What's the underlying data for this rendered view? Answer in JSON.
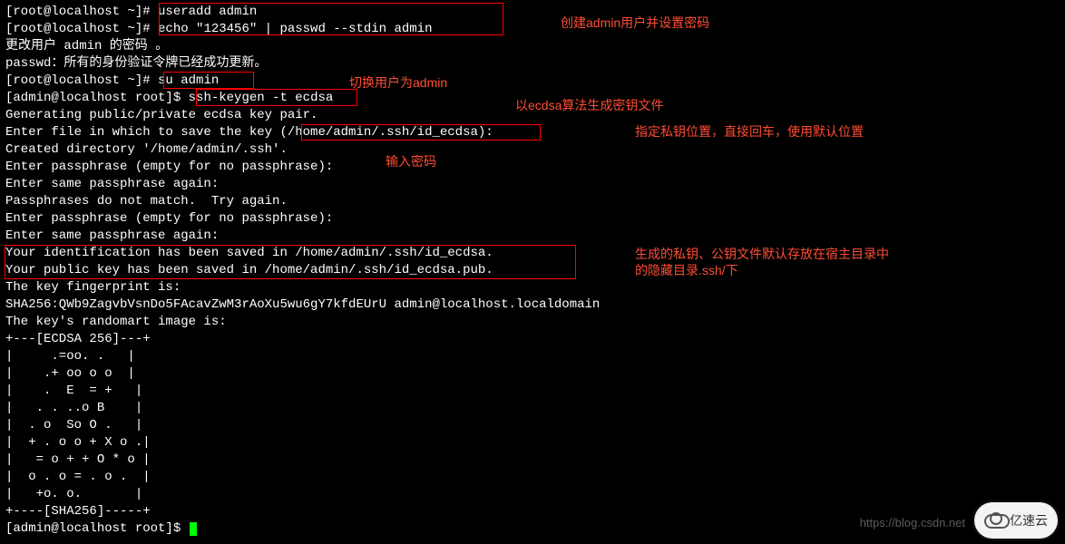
{
  "lines": [
    {
      "prefix": "[root@localhost ~]# ",
      "cmd": "useradd admin"
    },
    {
      "prefix": "[root@localhost ~]# ",
      "cmd": "echo \"123456\" | passwd --stdin admin"
    },
    {
      "text": "更改用户 admin 的密码 。"
    },
    {
      "text": "passwd：所有的身份验证令牌已经成功更新。"
    },
    {
      "prefix": "[root@localhost ~]# ",
      "cmd": "su admin"
    },
    {
      "prefix": "[admin@localhost root]$ ",
      "cmd": "ssh-keygen -t ecdsa"
    },
    {
      "text": "Generating public/private ecdsa key pair."
    },
    {
      "text": "Enter file in which to save the key (/home/admin/.ssh/id_ecdsa): "
    },
    {
      "text": "Created directory '/home/admin/.ssh'."
    },
    {
      "text": "Enter passphrase (empty for no passphrase): "
    },
    {
      "text": "Enter same passphrase again: "
    },
    {
      "text": "Passphrases do not match.  Try again."
    },
    {
      "text": "Enter passphrase (empty for no passphrase): "
    },
    {
      "text": "Enter same passphrase again: "
    },
    {
      "text": "Your identification has been saved in /home/admin/.ssh/id_ecdsa."
    },
    {
      "text": "Your public key has been saved in /home/admin/.ssh/id_ecdsa.pub."
    },
    {
      "text": "The key fingerprint is:"
    },
    {
      "text": "SHA256:QWb9ZagvbVsnDo5FAcavZwM3rAoXu5wu6gY7kfdEUrU admin@localhost.localdomain"
    },
    {
      "text": "The key's randomart image is:"
    },
    {
      "text": "+---[ECDSA 256]---+"
    },
    {
      "text": "|     .=oo. .   |"
    },
    {
      "text": "|    .+ oo o o  |"
    },
    {
      "text": "|    .  E  = +   |"
    },
    {
      "text": "|   . . ..o B    |"
    },
    {
      "text": "|  . o  So O .   |"
    },
    {
      "text": "|  + . o o + X o .|"
    },
    {
      "text": "|   = o + + O * o |"
    },
    {
      "text": "|  o . o = . o .  |"
    },
    {
      "text": "|   +o. o.       |"
    },
    {
      "text": "+----[SHA256]-----+"
    },
    {
      "prefix": "[admin@localhost root]$ ",
      "cmd": "",
      "showCursor": true
    }
  ],
  "annotations": {
    "a1": "创建admin用户并设置密码",
    "a2": "切换用户为admin",
    "a3": "以ecdsa算法生成密钥文件",
    "a4": "指定私钥位置，直接回车，使用默认位置",
    "a5": "输入密码",
    "a6": "生成的私钥、公钥文件默认存放在宿主目录中的隐藏目录.ssh/下"
  },
  "watermark": "https://blog.csdn.net",
  "logoText": "亿速云"
}
